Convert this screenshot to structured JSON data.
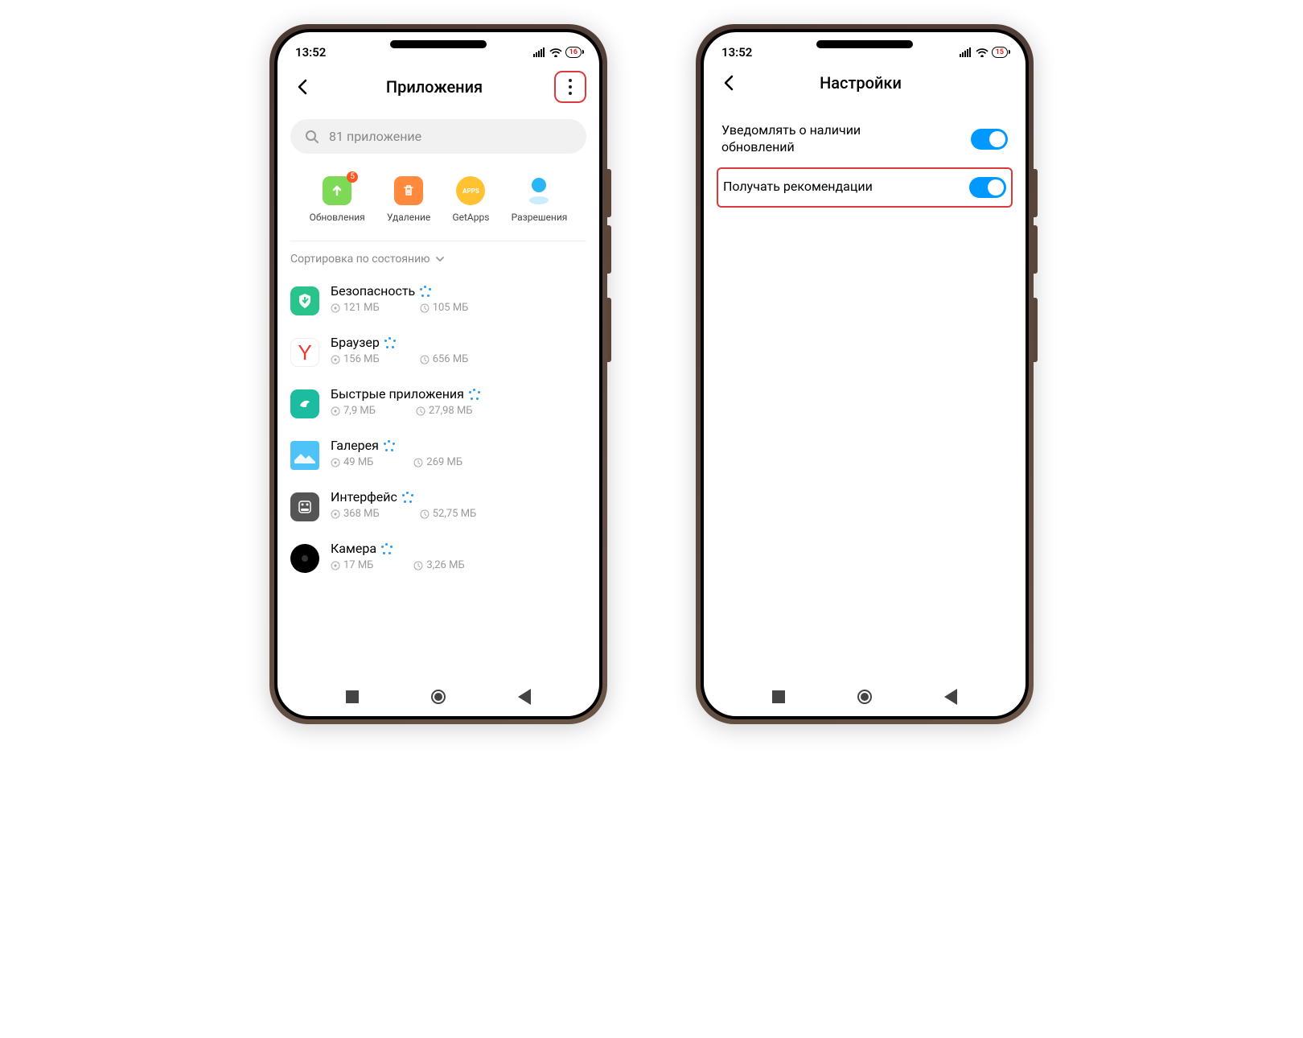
{
  "status": {
    "time": "13:52",
    "battery_left": "16",
    "battery_right": "15"
  },
  "left": {
    "title": "Приложения",
    "search_placeholder": "81 приложение",
    "quick": {
      "update": "Обновления",
      "update_badge": "5",
      "delete": "Удаление",
      "getapps": "GetApps",
      "perms": "Разрешения"
    },
    "sort": "Сортировка по состоянию",
    "apps": [
      {
        "name": "Безопасность",
        "storage": "121 МБ",
        "memory": "105 МБ",
        "icon_color": "#29c48c",
        "icon_glyph": "shield"
      },
      {
        "name": "Браузер",
        "storage": "156 МБ",
        "memory": "656 МБ",
        "icon_color": "#ffffff",
        "icon_glyph": "Y"
      },
      {
        "name": "Быстрые приложения",
        "storage": "7,9 МБ",
        "memory": "27,98 МБ",
        "icon_color": "#1bbca0",
        "icon_glyph": "swift"
      },
      {
        "name": "Галерея",
        "storage": "49 МБ",
        "memory": "269 МБ",
        "icon_color": "#4fc3f7",
        "icon_glyph": "gallery"
      },
      {
        "name": "Интерфейс",
        "storage": "368 МБ",
        "memory": "52,75 МБ",
        "icon_color": "#555",
        "icon_glyph": "ui"
      },
      {
        "name": "Камера",
        "storage": "17 МБ",
        "memory": "3,26 МБ",
        "icon_color": "#000",
        "icon_glyph": "camera"
      }
    ]
  },
  "right": {
    "title": "Настройки",
    "settings": [
      {
        "label": "Уведомлять о наличии обновлений",
        "on": true,
        "highlight": false
      },
      {
        "label": "Получать рекомендации",
        "on": true,
        "highlight": true
      }
    ]
  }
}
